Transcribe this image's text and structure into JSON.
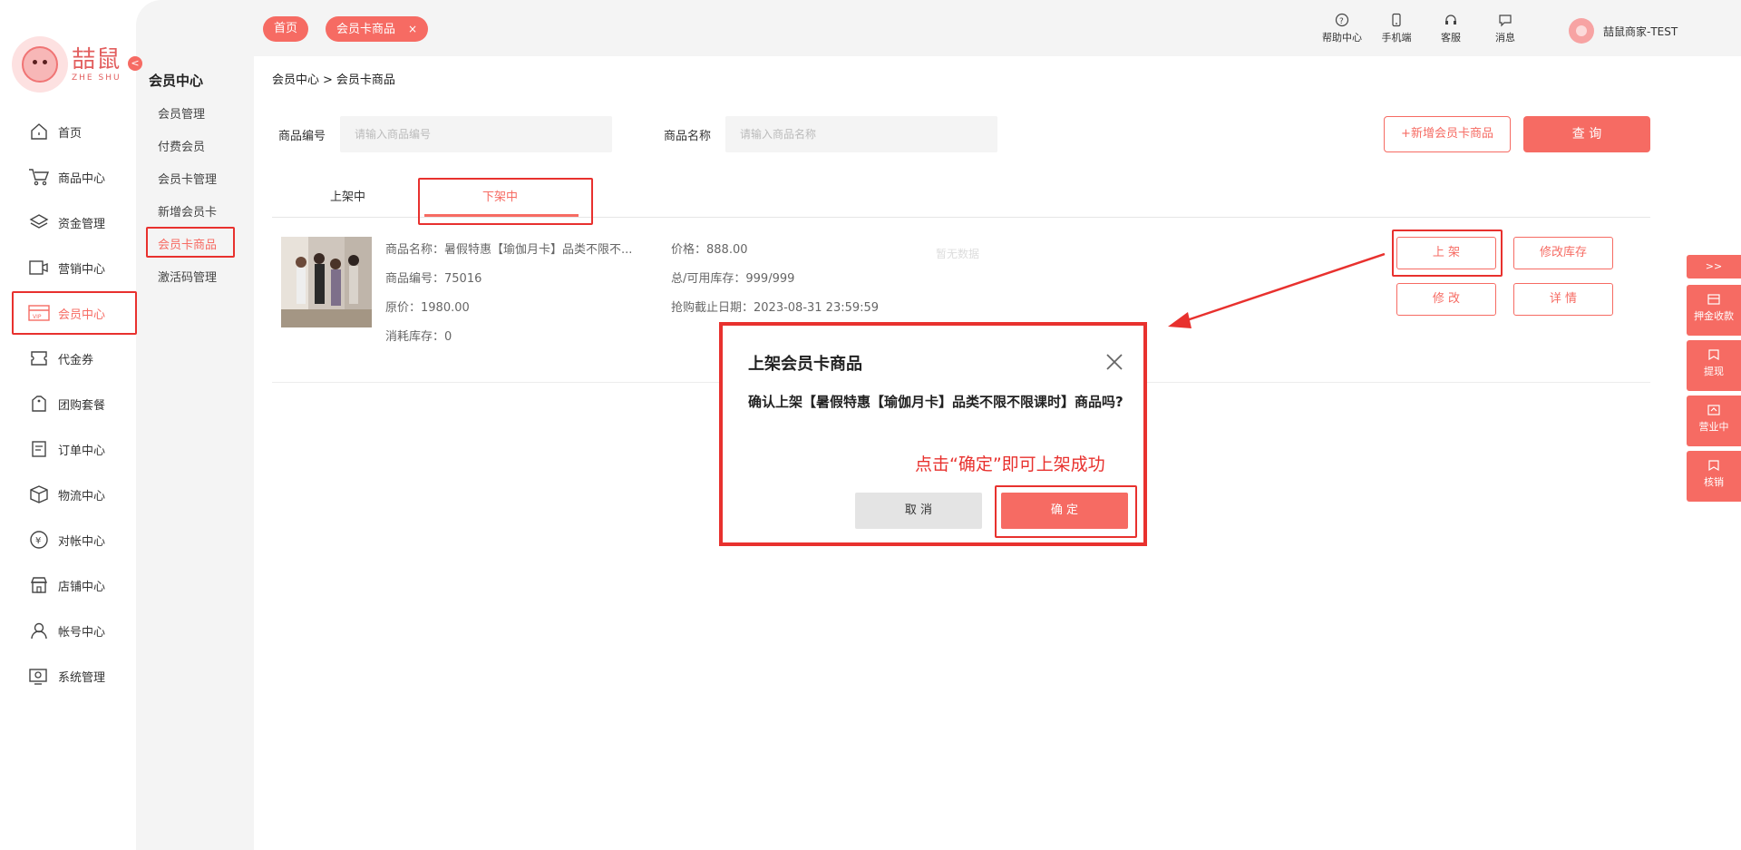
{
  "brand": {
    "name_cn": "喆鼠",
    "name_en": "ZHE SHU",
    "collapse_icon": "<"
  },
  "nav": {
    "items": [
      {
        "label": "首页",
        "icon": "home-icon"
      },
      {
        "label": "商品中心",
        "icon": "cart-icon"
      },
      {
        "label": "资金管理",
        "icon": "layers-icon"
      },
      {
        "label": "营销中心",
        "icon": "video-icon"
      },
      {
        "label": "会员中心",
        "icon": "vip-card-icon",
        "active": true
      },
      {
        "label": "代金券",
        "icon": "ticket-icon"
      },
      {
        "label": "团购套餐",
        "icon": "bag-icon"
      },
      {
        "label": "订单中心",
        "icon": "order-icon"
      },
      {
        "label": "物流中心",
        "icon": "box-icon"
      },
      {
        "label": "对帐中心",
        "icon": "yen-icon"
      },
      {
        "label": "店铺中心",
        "icon": "store-icon"
      },
      {
        "label": "帐号中心",
        "icon": "user-icon"
      },
      {
        "label": "系统管理",
        "icon": "system-icon"
      }
    ]
  },
  "subnav": {
    "title": "会员中心",
    "items": [
      "会员管理",
      "付费会员",
      "会员卡管理",
      "新增会员卡",
      "会员卡商品",
      "激活码管理"
    ],
    "active_index": 4
  },
  "topbar": {
    "tabs": [
      {
        "label": "首页"
      },
      {
        "label": "会员卡商品",
        "close": "×"
      }
    ],
    "tools": [
      {
        "label": "帮助中心",
        "icon": "help-icon"
      },
      {
        "label": "手机端",
        "icon": "phone-icon"
      },
      {
        "label": "客服",
        "icon": "headset-icon"
      },
      {
        "label": "消息",
        "icon": "message-icon"
      }
    ],
    "user": {
      "name": "喆鼠商家-TEST"
    }
  },
  "breadcrumb": {
    "root": "会员中心",
    "sep": ">",
    "current": "会员卡商品"
  },
  "filters": {
    "code_label": "商品编号",
    "code_placeholder": "请输入商品编号",
    "name_label": "商品名称",
    "name_placeholder": "请输入商品名称",
    "add_button": "+新增会员卡商品",
    "query_button": "查 询"
  },
  "tabs": {
    "on_shelf": "上架中",
    "off_shelf": "下架中",
    "active": "off_shelf"
  },
  "product": {
    "name": "商品名称：暑假特惠【瑜伽月卡】品类不限不...",
    "code": "商品编号：75016",
    "original_price": "原价：1980.00",
    "consumed_stock": "消耗库存：0",
    "price": "价格：888.00",
    "stock": "总/可用库存：999/999",
    "deadline": "抢购截止日期：2023-08-31 23:59:59",
    "no_data": "暂无数据",
    "actions": {
      "shelf": "上 架",
      "edit_stock": "修改库存",
      "edit": "修 改",
      "detail": "详 情"
    }
  },
  "right_bar": {
    "toggle": ">>",
    "items": [
      {
        "label": "押金收款",
        "icon": "wallet-icon"
      },
      {
        "label": "提现",
        "icon": "withdraw-icon"
      },
      {
        "label": "营业中",
        "icon": "shop-open-icon"
      },
      {
        "label": "核销",
        "icon": "verify-icon"
      }
    ]
  },
  "dialog": {
    "title": "上架会员卡商品",
    "message": "确认上架【暑假特惠【瑜伽月卡】品类不限不限课时】商品吗?",
    "tip": "点击“确定”即可上架成功",
    "cancel": "取 消",
    "confirm": "确 定"
  },
  "colors": {
    "accent": "#f66b63",
    "annotation": "#e8312e"
  }
}
